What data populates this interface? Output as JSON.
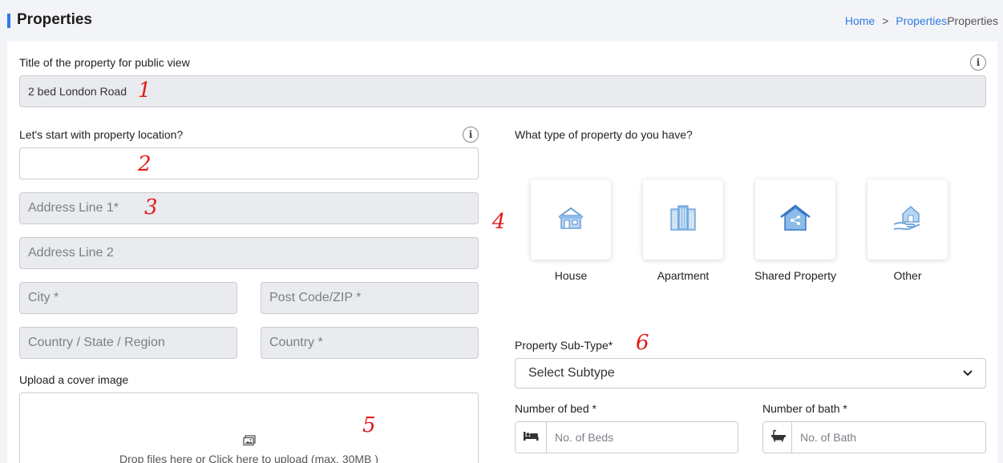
{
  "header": {
    "title": "Properties",
    "breadcrumb": {
      "home": "Home",
      "separator": ">",
      "current_link": "Properties",
      "current": "Properties"
    }
  },
  "form": {
    "title_label": "Title of the property for public view",
    "title_value": "2 bed London Road",
    "location_label": "Let's start with property location?",
    "location_value": "",
    "address1_placeholder": "Address Line 1*",
    "address2_placeholder": "Address Line 2",
    "city_placeholder": "City *",
    "postcode_placeholder": "Post Code/ZIP *",
    "region_placeholder": "Country / State / Region",
    "country_placeholder": "Country *",
    "cover_label": "Upload a cover image",
    "dropzone_text": "Drop files here or Click here to upload (max. 30MB )",
    "info_glyph": "i"
  },
  "property_type": {
    "question": "What type of property do you have?",
    "options": [
      {
        "label": "House",
        "icon": "house-icon"
      },
      {
        "label": "Apartment",
        "icon": "apartment-icon"
      },
      {
        "label": "Shared Property",
        "icon": "shared-property-icon"
      },
      {
        "label": "Other",
        "icon": "other-property-icon"
      }
    ]
  },
  "subtype": {
    "label": "Property Sub-Type*",
    "selected": "Select Subtype"
  },
  "beds": {
    "label": "Number of bed *",
    "placeholder": "No. of Beds",
    "icon": "bed-icon"
  },
  "baths": {
    "label": "Number of bath *",
    "placeholder": "No. of Bath",
    "icon": "bath-icon"
  },
  "annotations": [
    "1",
    "2",
    "3",
    "4",
    "5",
    "6"
  ],
  "colors": {
    "accent": "#2d7be5",
    "annotation": "#e21b1b",
    "icon_blue": "#7fb3e6"
  }
}
